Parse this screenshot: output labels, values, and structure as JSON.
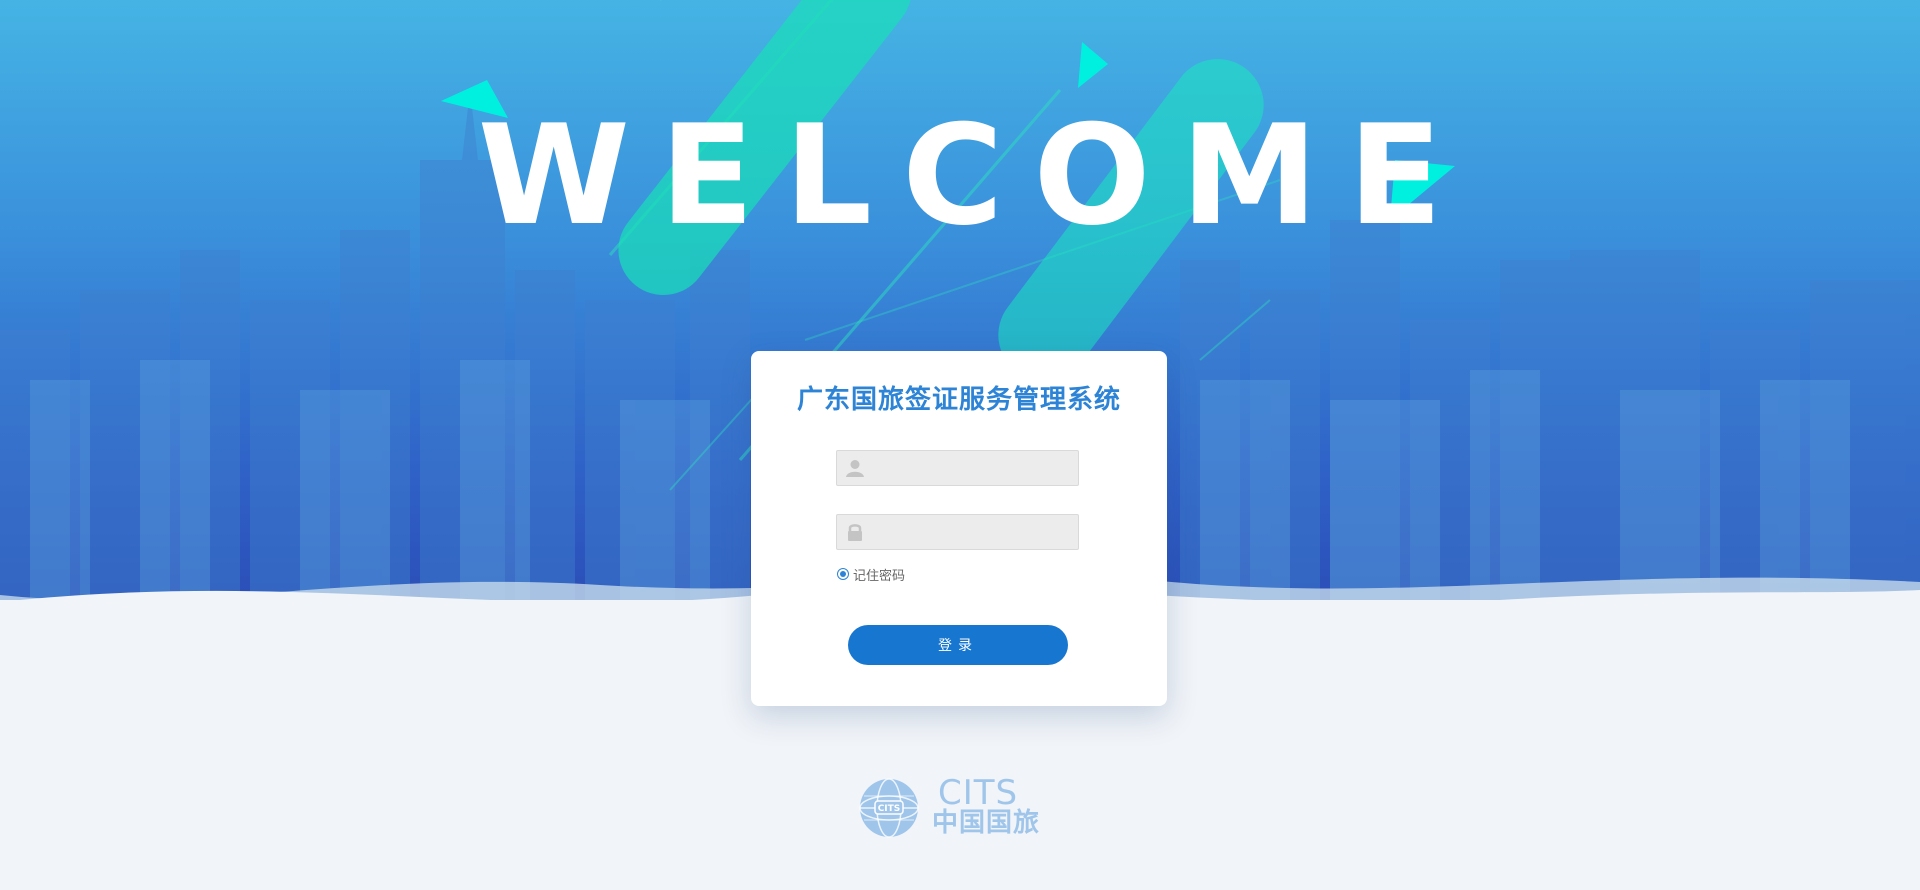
{
  "hero": {
    "headline": "WELCOME"
  },
  "login": {
    "title": "广东国旅签证服务管理系统",
    "username": {
      "value": "",
      "icon": "user-icon"
    },
    "password": {
      "value": "",
      "icon": "lock-icon"
    },
    "remember_label": "记住密码",
    "remember_checked": true,
    "submit_label": "登录"
  },
  "footer_logo": {
    "en": "CITS",
    "cn": "中国国旅",
    "globe_text": "CITS"
  },
  "colors": {
    "accent": "#1776cf",
    "title": "#2d84d6",
    "teal": "#18e0b8",
    "logo": "#9fc5ea"
  }
}
